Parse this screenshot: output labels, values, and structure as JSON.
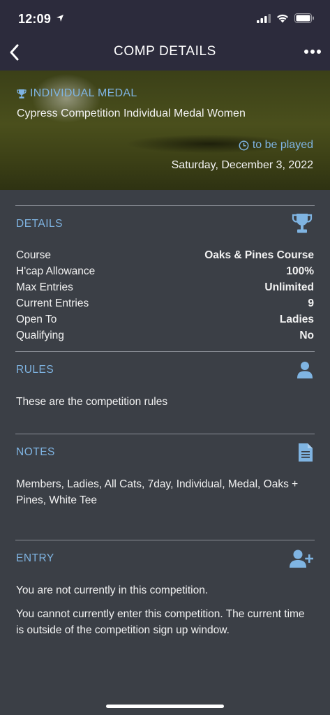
{
  "status_bar": {
    "time": "12:09"
  },
  "nav": {
    "title": "COMP DETAILS"
  },
  "hero": {
    "type_label": "INDIVIDUAL MEDAL",
    "competition_name": "Cypress Competition Individual Medal Women",
    "status": "to be played",
    "date": "Saturday, December 3, 2022"
  },
  "details": {
    "heading": "DETAILS",
    "rows": [
      {
        "label": "Course",
        "value": "Oaks & Pines Course"
      },
      {
        "label": "H'cap Allowance",
        "value": "100%"
      },
      {
        "label": "Max Entries",
        "value": "Unlimited"
      },
      {
        "label": "Current Entries",
        "value": "9"
      },
      {
        "label": "Open To",
        "value": "Ladies"
      },
      {
        "label": "Qualifying",
        "value": "No"
      }
    ]
  },
  "rules": {
    "heading": "RULES",
    "text": "These are the competition rules"
  },
  "notes": {
    "heading": "NOTES",
    "text": "Members, Ladies, All Cats, 7day, Individual, Medal, Oaks + Pines, White Tee"
  },
  "entry": {
    "heading": "ENTRY",
    "status_text": "You are not currently in this competition.",
    "info_text": "You cannot currently enter this competition. The current time is outside of the competition sign up window."
  },
  "icons": {
    "accent_color": "#7fb4e2",
    "trophy": "trophy-icon",
    "clock": "clock-icon",
    "person": "person-icon",
    "document": "document-icon",
    "add_person": "add-person-icon"
  },
  "colors": {
    "header_bg": "#2c2b3c",
    "page_bg": "#3b3f46",
    "accent": "#7fb4e2"
  }
}
